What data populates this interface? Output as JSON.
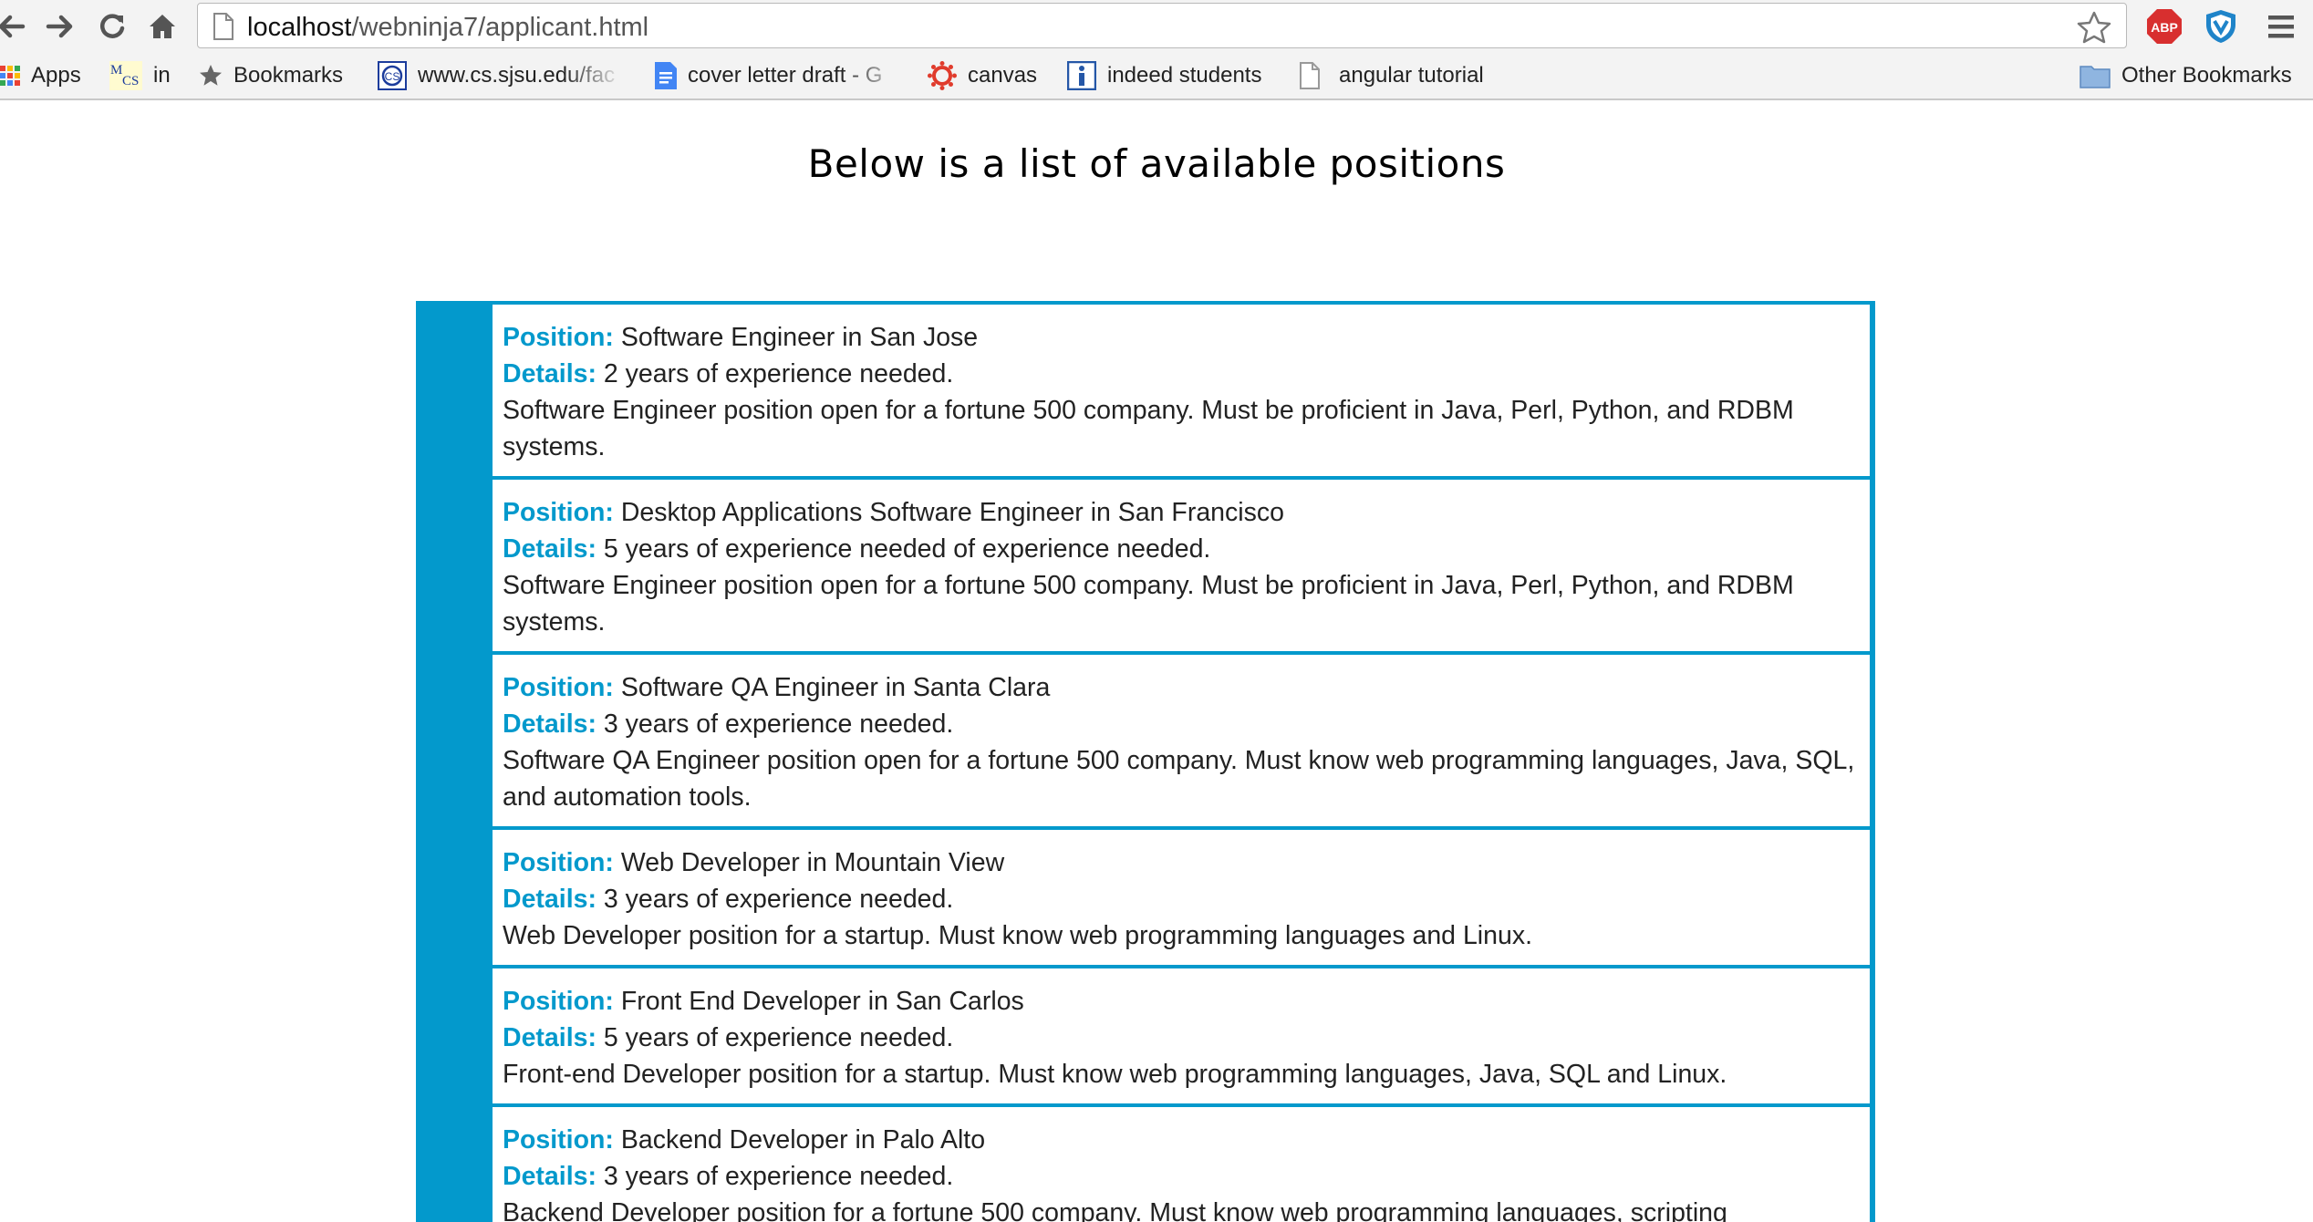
{
  "browser": {
    "url_host": "localhost",
    "url_path": "/webninja7/applicant.html",
    "extensions": [
      "ABP"
    ],
    "bookmarks": [
      {
        "label": "Apps",
        "icon": "apps-grid-icon"
      },
      {
        "label": "in",
        "icon": "mcs-icon"
      },
      {
        "label": "Bookmarks",
        "icon": "star-icon"
      },
      {
        "label": "www.cs.sjsu.edu/fac",
        "icon": "sjsu-icon"
      },
      {
        "label": "cover letter draft - G",
        "icon": "google-doc-icon"
      },
      {
        "label": "canvas",
        "icon": "canvas-icon"
      },
      {
        "label": "indeed students",
        "icon": "info-icon"
      },
      {
        "label": "angular tutorial",
        "icon": "page-icon"
      }
    ],
    "other_bookmarks": "Other Bookmarks"
  },
  "page": {
    "heading": "Below is a list of available positions",
    "position_label": "Position:",
    "details_label": "Details:",
    "positions": [
      {
        "title": "Software Engineer in San Jose",
        "experience": "2 years of experience needed.",
        "description": "Software Engineer position open for a fortune 500 company. Must be proficient in Java, Perl, Python, and RDBM systems."
      },
      {
        "title": "Desktop Applications Software Engineer in San Francisco",
        "experience": "5 years of experience needed of experience needed.",
        "description": "Software Engineer position open for a fortune 500 company. Must be proficient in Java, Perl, Python, and RDBM systems."
      },
      {
        "title": "Software QA Engineer in Santa Clara",
        "experience": "3 years of experience needed.",
        "description": "Software QA Engineer position open for a fortune 500 company. Must know web programming languages, Java, SQL, and automation tools."
      },
      {
        "title": "Web Developer in Mountain View",
        "experience": "3 years of experience needed.",
        "description": "Web Developer position for a startup. Must know web programming languages and Linux."
      },
      {
        "title": "Front End Developer in San Carlos",
        "experience": "5 years of experience needed.",
        "description": "Front-end Developer position for a startup. Must know web programming languages, Java, SQL and Linux."
      },
      {
        "title": "Backend Developer in Palo Alto",
        "experience": "3 years of experience needed.",
        "description": "Backend Developer position for a fortune 500 company. Must know web programming languages, scripting languages, and Linux."
      }
    ]
  },
  "colors": {
    "accent": "#0399cc",
    "abp_red": "#d82f2f"
  }
}
